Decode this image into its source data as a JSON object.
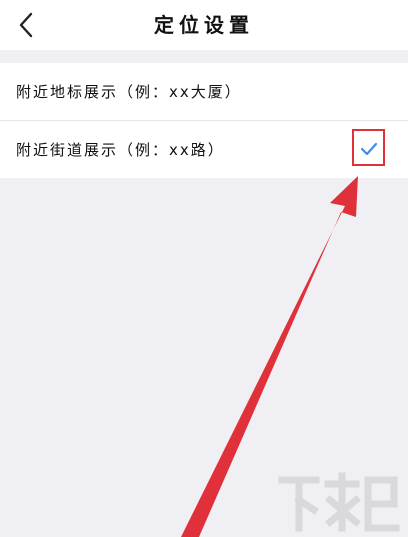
{
  "header": {
    "title": "定位设置",
    "back_icon": "chevron-left-icon"
  },
  "options": [
    {
      "label": "附近地标展示（例：xx大厦）",
      "selected": false
    },
    {
      "label": "附近街道展示（例：xx路）",
      "selected": true
    }
  ],
  "colors": {
    "check": "#3a8ee6",
    "annotation": "#e0303a",
    "background": "#efeff4"
  },
  "watermark_icon": "watermark-logo-icon"
}
